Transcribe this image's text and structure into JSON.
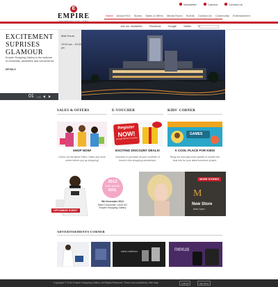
{
  "brand": {
    "name": "EMPIRE",
    "sub": "SHOPPING GALLERY",
    "mark": "E"
  },
  "utility": {
    "newsletter": "Newsletter",
    "careers": "Careers",
    "contact": "Contact Us"
  },
  "nav": {
    "items": [
      "Home",
      "About ESG",
      "Stores",
      "Sales & Offers",
      "Media Room",
      "Events",
      "Contact Us",
      "Community",
      "Entertainment"
    ],
    "active": 0
  },
  "subbar": {
    "prefix": "Join our newsletter",
    "links": [
      "Facebook",
      "Google",
      "Twitter",
      "RSS"
    ],
    "search_placeholder": ""
  },
  "hero": {
    "title": "EXCITEMENT SUPRISES GLAMOUR",
    "description": "Empire Shopping Gallery is the epitome of modernity, aesthetics and convenience",
    "more": "DETAILS",
    "hours_title": "Mall Hours",
    "hours_value": "10:00 am - 10:00 pm",
    "slide": "01",
    "total": "/ 04"
  },
  "columns": [
    {
      "heading": "SALES & OFFERS",
      "caption": "SHOP NOW!",
      "text": "Check out the latest Offers, Sales and more online before you go shopping!"
    },
    {
      "heading": "E-VOUCHER",
      "caption": "EXCITING DISCOUNT DEALS!",
      "text": "Amounts in purchase all your comforts of home in this shopping wonderland."
    },
    {
      "heading": "KIDS' CORNER",
      "caption": "A COOL PLACE FOR KIDS!",
      "text": "Bring out and play some games or master the final ride for your latest tomorrow project."
    }
  ],
  "voucher_art": {
    "line1": "Register",
    "line2": "NOW!",
    "note": "and get RM10 e-Voucher"
  },
  "kids_art": {
    "label": "GAMES"
  },
  "promo1": {
    "tag": "UPCOMING EVENT",
    "year": "2012",
    "badge_line1": "ONE MUSIC",
    "badge_line2": "IDOL",
    "date": "9th December 2012",
    "venue1": "Main Concourse, Level UG",
    "venue2": "Empire Shopping Gallery"
  },
  "promo2": {
    "tag": "MORE STORES",
    "title": "New Store",
    "sub": "Now Open"
  },
  "ads": {
    "heading": "ADVERTISEMENTS CORNER",
    "ad3_text": "latest collection",
    "ad4_brand": "nexus"
  },
  "footer": {
    "copyright": "Copyright © 2012 Empire Shopping Gallery. All Rights Reserved.   Terms and conditions  |  Site Map",
    "store1": "Android",
    "store2": "App Store"
  },
  "colors": {
    "accent": "#c41d2a",
    "dark": "#2b2b2b"
  }
}
